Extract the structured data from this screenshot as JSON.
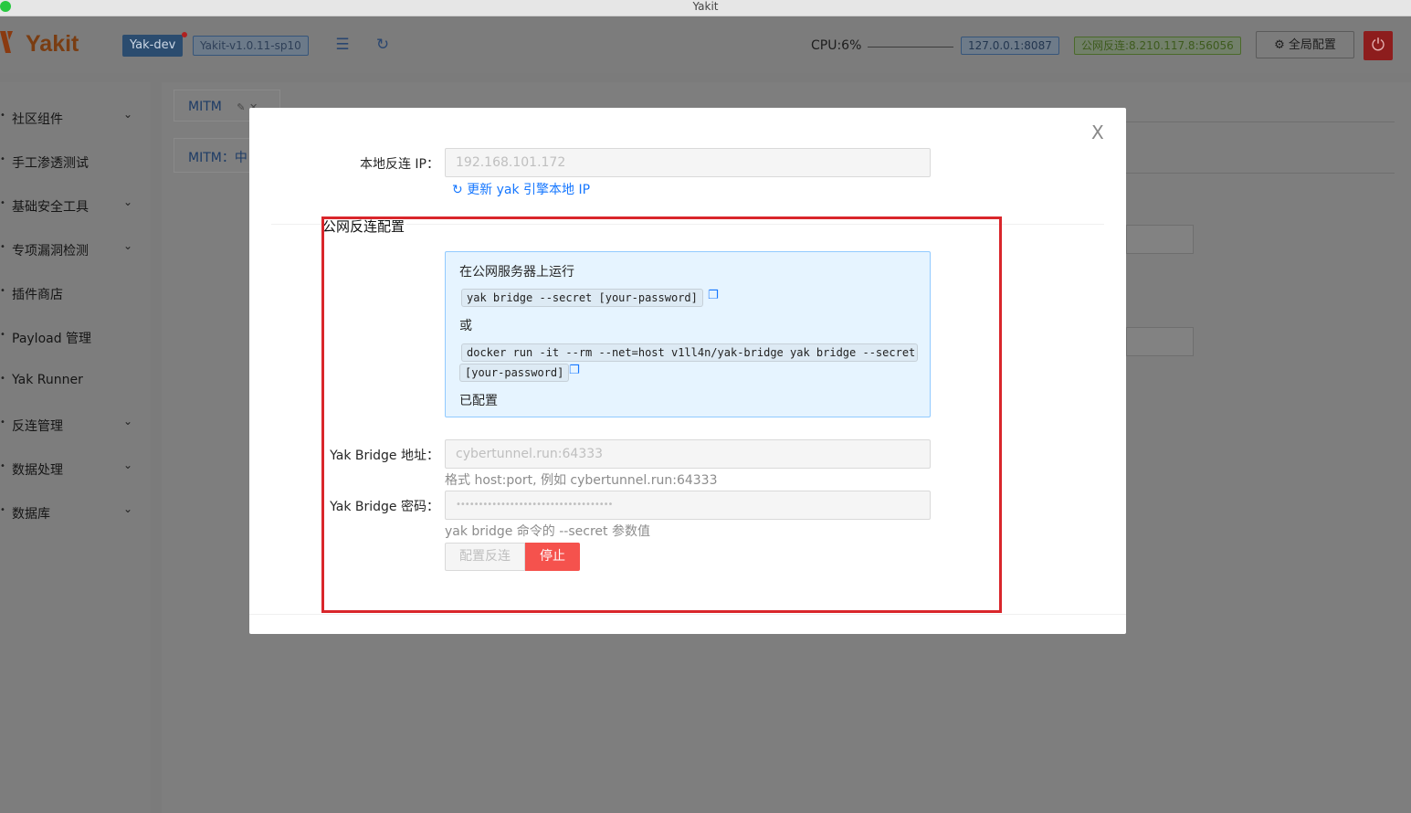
{
  "window": {
    "title": "Yakit"
  },
  "header": {
    "logo": "Yakit",
    "engine_tag": "Yak-dev",
    "version_tag": "Yakit-v1.0.11-sp10",
    "cpu": "CPU:6%",
    "local_addr": "127.0.0.1:8087",
    "public_reverse": "公网反连:8.210.117.8:56056",
    "global_config": "全局配置",
    "icons": [
      "menu-fold-icon",
      "reload-icon",
      "gear-icon",
      "power-icon"
    ]
  },
  "sidebar": {
    "items": [
      {
        "label": "社区组件",
        "expandable": true
      },
      {
        "label": "手工渗透测试",
        "expandable": false
      },
      {
        "label": "基础安全工具",
        "expandable": true
      },
      {
        "label": "专项漏洞检测",
        "expandable": true
      },
      {
        "label": "插件商店",
        "expandable": false
      },
      {
        "label": "Payload 管理",
        "expandable": false
      },
      {
        "label": "Yak Runner",
        "expandable": false
      },
      {
        "label": "反连管理",
        "expandable": true
      },
      {
        "label": "数据处理",
        "expandable": true
      },
      {
        "label": "数据库",
        "expandable": true
      }
    ]
  },
  "tabs": {
    "main_tab": "MITM",
    "sub_tab": "MITM：中"
  },
  "modal": {
    "local_ip_label": "本地反连 IP：",
    "local_ip_value": "192.168.101.172",
    "refresh_link": "更新 yak 引擎本地 IP",
    "section_title": "公网反连配置",
    "info": {
      "title": "在公网服务器上运行",
      "cmd1": "yak bridge --secret [your-password]",
      "or": "或",
      "cmd2_line1": "docker run -it --rm --net=host v1ll4n/yak-bridge yak bridge --secret",
      "cmd2_line2": "[your-password]",
      "status": "已配置"
    },
    "bridge_addr_label": "Yak Bridge 地址：",
    "bridge_addr_value": "cybertunnel.run:64333",
    "bridge_addr_help": "格式 host:port, 例如 cybertunnel.run:64333",
    "bridge_pwd_label": "Yak Bridge 密码：",
    "bridge_pwd_value": "•••••••••••••••••••••••••••••••••••",
    "bridge_pwd_help": "yak bridge 命令的 --secret 参数值",
    "configure_button": "配置反连",
    "stop_button": "停止",
    "close": "X"
  },
  "colors": {
    "highlight_box": "#d9262b",
    "primary": "#1677ff",
    "danger": "#f5524d"
  }
}
